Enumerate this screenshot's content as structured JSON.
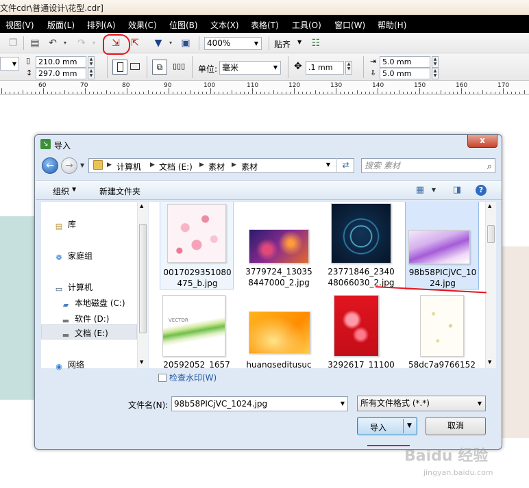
{
  "app": {
    "title_fragment": "文件cdr\\普通设计\\花型.cdr]"
  },
  "menu": [
    {
      "label": "视图(V)"
    },
    {
      "label": "版面(L)"
    },
    {
      "label": "排列(A)"
    },
    {
      "label": "效果(C)"
    },
    {
      "label": "位图(B)"
    },
    {
      "label": "文本(X)"
    },
    {
      "label": "表格(T)"
    },
    {
      "label": "工具(O)"
    },
    {
      "label": "窗口(W)"
    },
    {
      "label": "帮助(H)"
    }
  ],
  "toolbar": {
    "zoom": "400%",
    "snap_label": "贴齐",
    "icons": [
      "copy-icon",
      "undo-icon",
      "redo-icon",
      "import-icon",
      "export-icon",
      "publish-icon",
      "application-launcher-icon",
      "options-icon"
    ]
  },
  "property_bar": {
    "width": "210.0 mm",
    "height": "297.0 mm",
    "unit_label": "单位:",
    "unit_value": "毫米",
    "nudge": ".1 mm",
    "dup_x": "5.0 mm",
    "dup_y": "5.0 mm"
  },
  "ruler": {
    "labels": [
      "60",
      "70",
      "80",
      "90",
      "100",
      "110",
      "120",
      "130",
      "140",
      "150",
      "160",
      "170"
    ]
  },
  "dialog": {
    "title": "导入",
    "close_glyph": "x",
    "address": {
      "crumbs": [
        "计算机",
        "文档 (E:)",
        "素材",
        "素材"
      ]
    },
    "search_placeholder": "搜索 素材",
    "command_bar": {
      "organize": "组织",
      "new_folder": "新建文件夹"
    },
    "nav": {
      "library": "库",
      "homegroup": "家庭组",
      "computer": "计算机",
      "drive_c": "本地磁盘 (C:)",
      "drive_d": "软件 (D:)",
      "drive_e": "文档 (E:)",
      "network": "网络"
    },
    "files": [
      {
        "name": "0017029351080475_b.jpg",
        "line1": "0017029351080",
        "line2": "475_b.jpg"
      },
      {
        "name": "3779724_130358447000_2.jpg",
        "line1": "3779724_13035",
        "line2": "8447000_2.jpg"
      },
      {
        "name": "23771846_234048066030_2.jpg",
        "line1": "23771846_2340",
        "line2": "48066030_2.jpg"
      },
      {
        "name": "98b58PICjVC_1024.jpg",
        "line1": "98b58PICjVC_10",
        "line2": "24.jpg"
      },
      {
        "name": "20592052_1657",
        "line1": "20592052_1657",
        "line2": ""
      },
      {
        "name": "huangseditusuc",
        "line1": "huangseditusuc",
        "line2": ""
      },
      {
        "name": "3292617_11100",
        "line1": "3292617_11100",
        "line2": ""
      },
      {
        "name": "58dc7a9766152",
        "line1": "58dc7a9766152",
        "line2": ""
      }
    ],
    "thumb_caption_vector": "VECTOR",
    "watermark_label": "检查水印(W)",
    "filename_label": "文件名(N):",
    "filename_value": "98b58PICjVC_1024.jpg",
    "filetype_value": "所有文件格式 (*.*)",
    "import_button": "导入",
    "cancel_button": "取消"
  },
  "watermark": {
    "brand": "Baidu 经验",
    "url": "jingyan.baidu.com"
  },
  "colors": {
    "menubar": "#000000",
    "annotation_red": "#e5151c",
    "dialog_frame": "#dfe9f5",
    "selected_file": "#d8e7fb"
  }
}
